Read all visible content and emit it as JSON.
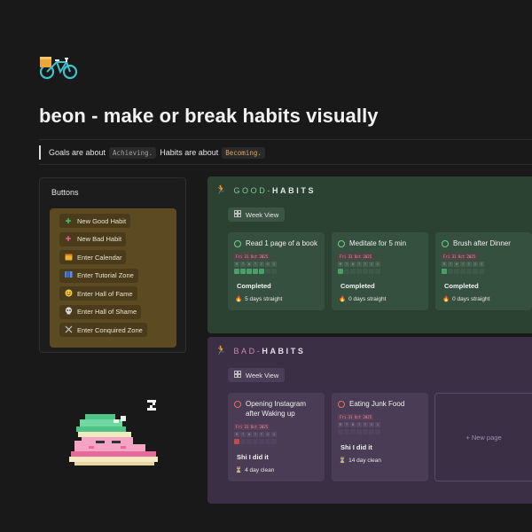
{
  "page": {
    "title": "beon - make or break habits visually",
    "quote": {
      "part1": "Goals are about",
      "code1": "Achieving.",
      "part2": "Habits are about",
      "code2": "Becoming."
    }
  },
  "buttons": {
    "header": "Buttons",
    "items": [
      {
        "label": "New Good Habit",
        "icon": "plus-green-icon"
      },
      {
        "label": "New Bad Habit",
        "icon": "plus-pink-icon"
      },
      {
        "label": "Enter Calendar",
        "icon": "calendar-icon"
      },
      {
        "label": "Enter Tutorial Zone",
        "icon": "books-icon"
      },
      {
        "label": "Enter Hall of Fame",
        "icon": "smiley-icon"
      },
      {
        "label": "Enter Hall of Shame",
        "icon": "skull-icon"
      },
      {
        "label": "Enter Conquired Zone",
        "icon": "swords-icon"
      }
    ]
  },
  "good": {
    "title_a": "GOOD-",
    "title_b": "HABITS",
    "view": "Week View",
    "cards": [
      {
        "name": "Read 1 page of a book",
        "date": "Fri 31 Oct 2025",
        "status": "Completed",
        "streak": "5 days straight",
        "checks": [
          1,
          1,
          1,
          1,
          1,
          0,
          0
        ]
      },
      {
        "name": "Meditate for 5 min",
        "date": "Fri 31 Oct 2025",
        "status": "Completed",
        "streak": "0 days straight",
        "checks": [
          1,
          0,
          0,
          0,
          0,
          0,
          0
        ]
      },
      {
        "name": "Brush after Dinner",
        "date": "Fri 31 Oct 2025",
        "status": "Completed",
        "streak": "0 days straight",
        "checks": [
          1,
          0,
          0,
          0,
          0,
          0,
          0
        ]
      }
    ]
  },
  "bad": {
    "title_a": "BAD-",
    "title_b": "HABITS",
    "view": "Week View",
    "cards": [
      {
        "name": "Opening Instagram after Waking up",
        "date": "Fri 31 Oct 2025",
        "status": "Shi I did it",
        "streak": "4 day clean",
        "checks": [
          1,
          0,
          0,
          0,
          0,
          0,
          0
        ]
      },
      {
        "name": "Eating Junk Food",
        "date": "Fri 31 Oct 2025",
        "status": "Shi I did it",
        "streak": "14 day clean",
        "checks": [
          0,
          0,
          0,
          0,
          0,
          0,
          0
        ]
      }
    ],
    "new_page": "+ New page"
  },
  "weekdays": [
    "M",
    "T",
    "W",
    "T",
    "F",
    "S",
    "S"
  ],
  "colors": {
    "background": "#191919",
    "good_section": "#2b4233",
    "bad_section": "#3b2f45",
    "buttons_panel": "#5c4b22"
  }
}
